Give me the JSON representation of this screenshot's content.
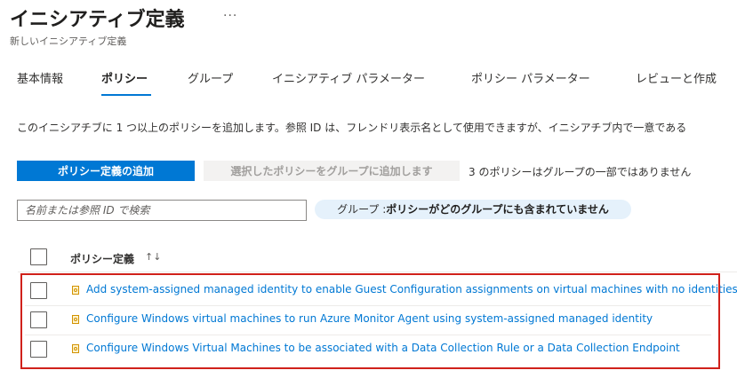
{
  "header": {
    "title": "イニシアティブ定義",
    "more_label": "···",
    "subtitle": "新しいイニシアティブ定義"
  },
  "tabs": [
    {
      "label": "基本情報",
      "active": false
    },
    {
      "label": "ポリシー",
      "active": true
    },
    {
      "label": "グループ",
      "active": false
    },
    {
      "label": "イニシアティブ パラメーター",
      "active": false
    },
    {
      "label": "ポリシー パラメーター",
      "active": false
    },
    {
      "label": "レビューと作成",
      "active": false
    }
  ],
  "description": "このイニシアチブに 1 つ以上のポリシーを追加します。参照 ID は、フレンドリ表示名として使用できますが、イニシアチブ内で一意である",
  "toolbar": {
    "add_policy_label": "ポリシー定義の追加",
    "add_to_group_label": "選択したポリシーをグループに追加します",
    "status_text": "3 のポリシーはグループの一部ではありません"
  },
  "search": {
    "placeholder": "名前または参照 ID で検索",
    "value": ""
  },
  "filter_pill": {
    "label": "グループ : ",
    "value": "ポリシーがどのグループにも含まれていません"
  },
  "table": {
    "column_header": "ポリシー定義",
    "sort_icon": "↑↓",
    "rows": [
      {
        "name": "Add system-assigned managed identity to enable Guest Configuration assignments on virtual machines with no identities"
      },
      {
        "name": "Configure Windows virtual machines to run Azure Monitor Agent using system-assigned managed identity"
      },
      {
        "name": "Configure Windows Virtual Machines to be associated with a Data Collection Rule or a Data Collection Endpoint"
      }
    ]
  },
  "colors": {
    "accent": "#0078d4",
    "highlight": "#d0211b",
    "pill_bg": "#e5f1fb"
  },
  "icons": {
    "more": "ellipsis-icon",
    "sort": "sort-icon",
    "policy": "policy-definition-icon"
  }
}
